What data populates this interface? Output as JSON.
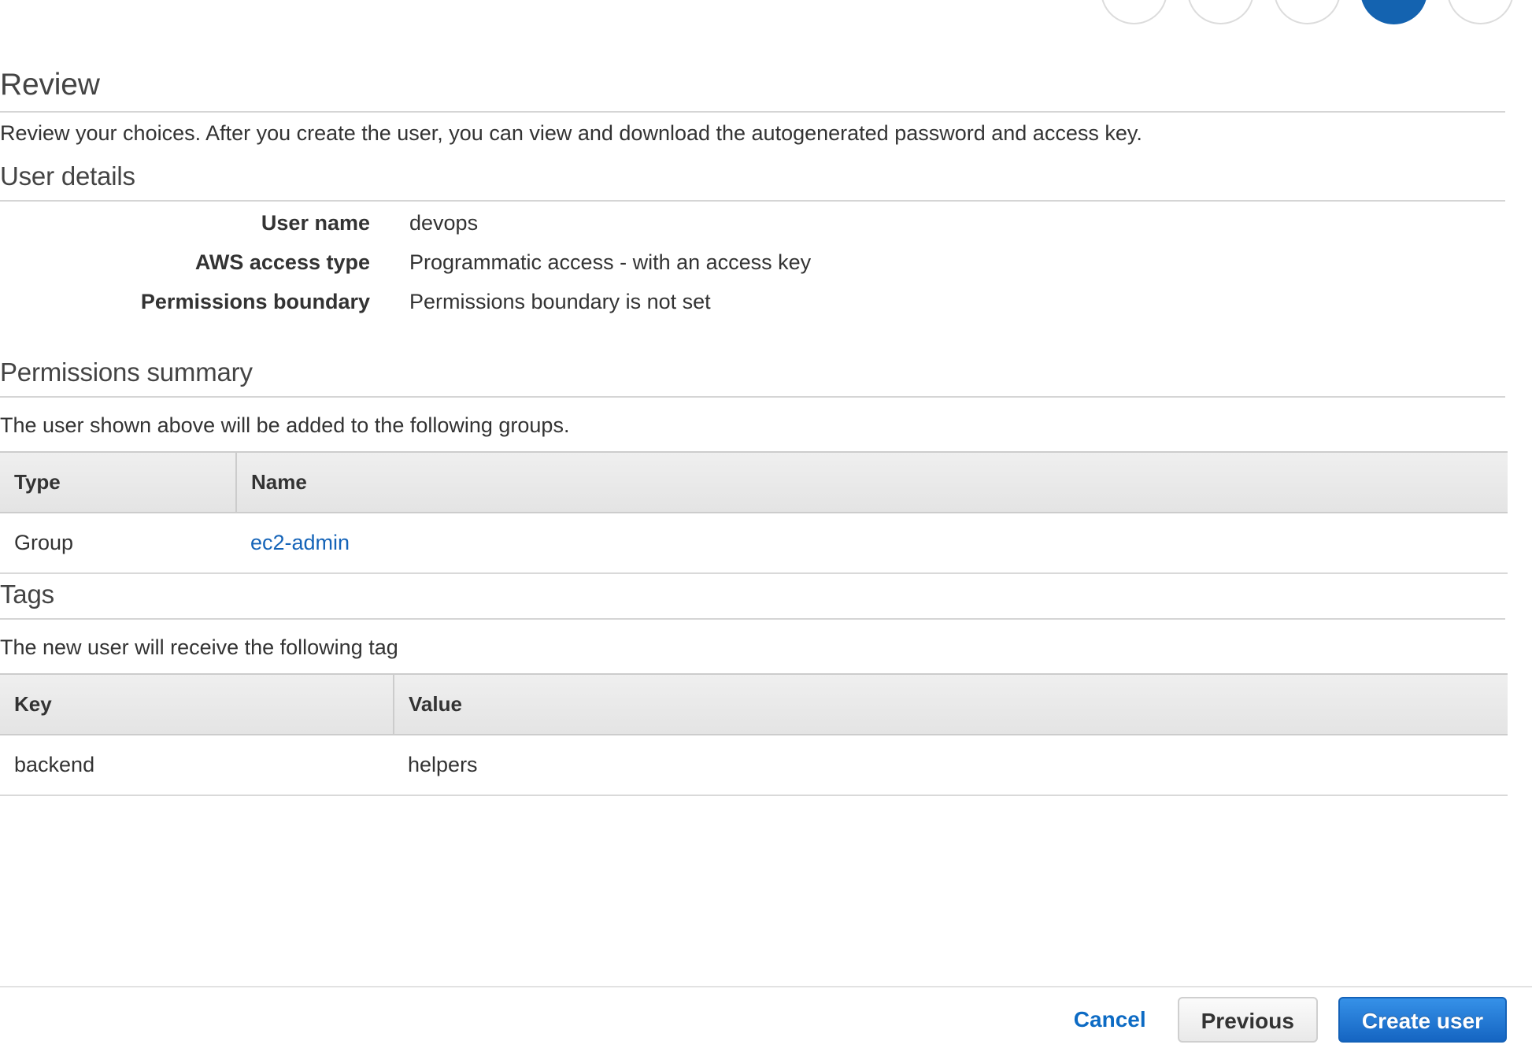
{
  "wizard": {
    "steps": [
      {
        "name": "step-1",
        "state": "incomplete"
      },
      {
        "name": "step-2",
        "state": "incomplete"
      },
      {
        "name": "step-3",
        "state": "incomplete"
      },
      {
        "name": "step-4",
        "state": "active"
      },
      {
        "name": "step-5",
        "state": "incomplete"
      }
    ],
    "active_color": "#1463b0",
    "inactive_border_color": "#dcdcdc"
  },
  "review": {
    "title": "Review",
    "description": "Review your choices. After you create the user, you can view and download the autogenerated password and access key."
  },
  "user_details": {
    "title": "User details",
    "rows": [
      {
        "label": "User name",
        "value": "devops"
      },
      {
        "label": "AWS access type",
        "value": "Programmatic access - with an access key"
      },
      {
        "label": "Permissions boundary",
        "value": "Permissions boundary is not set"
      }
    ]
  },
  "permissions_summary": {
    "title": "Permissions summary",
    "description": "The user shown above will be added to the following groups.",
    "columns": [
      "Type",
      "Name"
    ],
    "rows": [
      {
        "type": "Group",
        "name": "ec2-admin",
        "name_is_link": true
      }
    ],
    "link_color": "#1463b8"
  },
  "tags": {
    "title": "Tags",
    "description": "The new user will receive the following tag",
    "columns": [
      "Key",
      "Value"
    ],
    "rows": [
      {
        "key": "backend",
        "value": "helpers"
      }
    ]
  },
  "footer": {
    "cancel_label": "Cancel",
    "previous_label": "Previous",
    "create_label": "Create user",
    "primary_color": "#1565c2",
    "link_color": "#0d6bc4"
  }
}
